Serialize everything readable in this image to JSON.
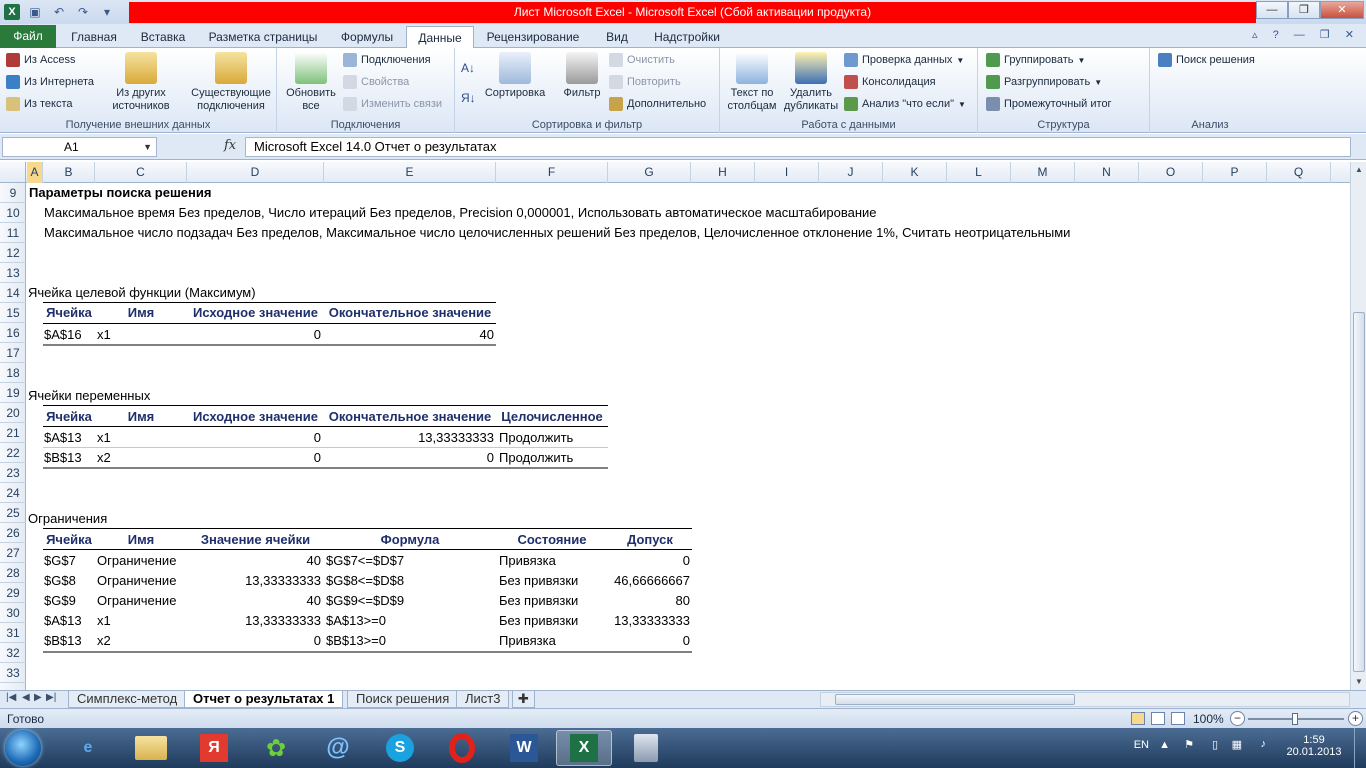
{
  "window": {
    "title": "Лист Microsoft Excel  -  Microsoft Excel (Сбой активации продукта)"
  },
  "ribbon_tabs": [
    "Файл",
    "Главная",
    "Вставка",
    "Разметка страницы",
    "Формулы",
    "Данные",
    "Рецензирование",
    "Вид",
    "Надстройки"
  ],
  "ribbon": {
    "external": {
      "from_access": "Из Access",
      "from_web": "Из Интернета",
      "from_text": "Из текста",
      "from_other_1": "Из других",
      "from_other_2": "источников",
      "existing_1": "Существующие",
      "existing_2": "подключения",
      "label": "Получение внешних данных"
    },
    "connections": {
      "refresh_1": "Обновить",
      "refresh_2": "все",
      "connections": "Подключения",
      "properties": "Свойства",
      "edit_links": "Изменить связи",
      "label": "Подключения"
    },
    "sort": {
      "sort": "Сортировка",
      "filter": "Фильтр",
      "clear": "Очистить",
      "reapply": "Повторить",
      "advanced": "Дополнительно",
      "label": "Сортировка и фильтр"
    },
    "datatools": {
      "text_cols_1": "Текст по",
      "text_cols_2": "столбцам",
      "remove_dup_1": "Удалить",
      "remove_dup_2": "дубликаты",
      "validation": "Проверка данных",
      "consolidate": "Консолидация",
      "whatif": "Анализ \"что если\"",
      "label": "Работа с данными"
    },
    "outline": {
      "group": "Группировать",
      "ungroup": "Разгруппировать",
      "subtotal": "Промежуточный итог",
      "label": "Структура"
    },
    "analysis": {
      "solver": "Поиск решения",
      "label": "Анализ"
    }
  },
  "formula_bar": {
    "name_box": "A1",
    "fx": "fx",
    "content": "Microsoft Excel 14.0 Отчет о результатах"
  },
  "columns": [
    "A",
    "B",
    "C",
    "D",
    "E",
    "F",
    "G",
    "H",
    "I",
    "J",
    "K",
    "L",
    "M",
    "N",
    "O",
    "P",
    "Q"
  ],
  "rows": [
    "9",
    "10",
    "11",
    "12",
    "13",
    "14",
    "15",
    "16",
    "17",
    "18",
    "19",
    "20",
    "21",
    "22",
    "23",
    "24",
    "25",
    "26",
    "27",
    "28",
    "29",
    "30",
    "31",
    "32",
    "33"
  ],
  "report": {
    "r9": "Параметры поиска решения",
    "r10": "Максимальное время Без пределов,  Число итераций Без пределов, Precision 0,000001, Использовать автоматическое масштабирование",
    "r11": "Максимальное число подзадач Без пределов, Максимальное число целочисленных решений Без пределов, Целочисленное отклонение 1%, Считать неотрицательными",
    "r14": "Ячейка целевой функции (Максимум)",
    "objective_headers": [
      "Ячейка",
      "Имя",
      "Исходное значение",
      "Окончательное значение"
    ],
    "objective_rows": [
      [
        "$A$16",
        "x1",
        "0",
        "40"
      ]
    ],
    "r19": "Ячейки переменных",
    "variable_headers": [
      "Ячейка",
      "Имя",
      "Исходное значение",
      "Окончательное значение",
      "Целочисленное"
    ],
    "variable_rows": [
      [
        "$A$13",
        "x1",
        "0",
        "13,33333333",
        "Продолжить"
      ],
      [
        "$B$13",
        "x2",
        "0",
        "0",
        "Продолжить"
      ]
    ],
    "r25": "Ограничения",
    "constraint_headers": [
      "Ячейка",
      "Имя",
      "Значение ячейки",
      "Формула",
      "Состояние",
      "Допуск"
    ],
    "constraint_rows": [
      [
        "$G$7",
        "Ограничение",
        "40",
        "$G$7<=$D$7",
        "Привязка",
        "0"
      ],
      [
        "$G$8",
        "Ограничение",
        "13,33333333",
        "$G$8<=$D$8",
        "Без привязки",
        "46,66666667"
      ],
      [
        "$G$9",
        "Ограничение",
        "40",
        "$G$9<=$D$9",
        "Без привязки",
        "80"
      ],
      [
        "$A$13",
        "x1",
        "13,33333333",
        "$A$13>=0",
        "Без привязки",
        "13,33333333"
      ],
      [
        "$B$13",
        "x2",
        "0",
        "$B$13>=0",
        "Привязка",
        "0"
      ]
    ]
  },
  "sheet_tabs": [
    "Симплекс-метод",
    "Отчет о результатах 1",
    "Поиск решения",
    "Лист3"
  ],
  "status": {
    "ready": "Готово",
    "zoom": "100%"
  },
  "taskbar": {
    "lang": "EN",
    "time": "1:59",
    "date": "20.01.2013"
  }
}
